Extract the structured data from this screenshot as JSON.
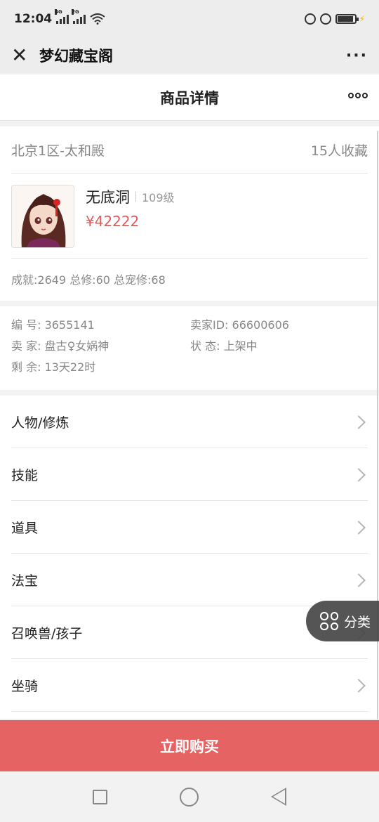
{
  "status_bar": {
    "time": "12:04",
    "network_1": "4G",
    "network_2": "2G",
    "icons": [
      "signal-icon",
      "signal-icon",
      "wifi-icon",
      "lock-icon",
      "alarm-icon",
      "battery-icon"
    ]
  },
  "wechat_bar": {
    "close_icon": "close-icon",
    "title": "梦幻藏宝阁",
    "more_icon": "more-icon"
  },
  "header": {
    "title": "商品详情",
    "more_icon": "more-dots-icon"
  },
  "product": {
    "server": "北京1区-太和殿",
    "favorites": "15人收藏",
    "name": "无底洞",
    "level": "109级",
    "price": "¥42222",
    "stats": "成就:2649 总修:60 总宠修:68"
  },
  "details": {
    "id": "编 号: 3655141",
    "seller_id": "卖家ID: 66600606",
    "seller": "卖 家: 盘古♀女娲神",
    "status": "状 态: 上架中",
    "remaining": "剩 余: 13天22时"
  },
  "menu": [
    {
      "label": "人物/修炼"
    },
    {
      "label": "技能"
    },
    {
      "label": "道具"
    },
    {
      "label": "法宝"
    },
    {
      "label": "召唤兽/孩子"
    },
    {
      "label": "坐骑"
    }
  ],
  "fab": {
    "label": "分类",
    "icon": "category-icon"
  },
  "buy_button": {
    "label": "立即购买"
  },
  "colors": {
    "accent": "#e56363",
    "price": "#e05a5a"
  }
}
